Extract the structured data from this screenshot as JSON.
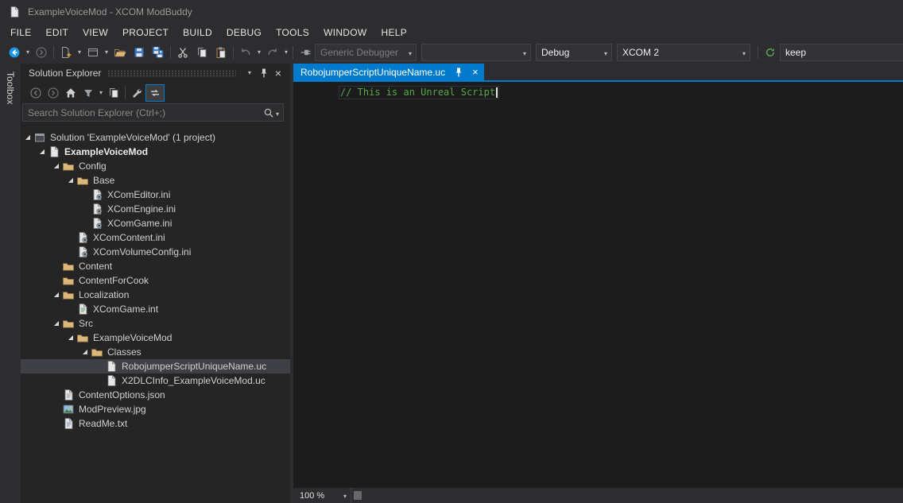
{
  "window": {
    "title": "ExampleVoiceMod - XCOM ModBuddy"
  },
  "menu": {
    "items": [
      "FILE",
      "EDIT",
      "VIEW",
      "PROJECT",
      "BUILD",
      "DEBUG",
      "TOOLS",
      "WINDOW",
      "HELP"
    ]
  },
  "toolbar": {
    "debugger_label": "Generic Debugger",
    "empty_value": "",
    "config_value": "Debug",
    "platform_value": "XCOM 2",
    "keep_value": "keep"
  },
  "toolbox": {
    "label": "Toolbox"
  },
  "solution_explorer": {
    "title": "Solution Explorer",
    "search_placeholder": "Search Solution Explorer (Ctrl+;)",
    "tree": [
      {
        "label": "Solution 'ExampleVoiceMod' (1 project)",
        "level": 0,
        "icon": "solution",
        "expanded": true
      },
      {
        "label": "ExampleVoiceMod",
        "level": 1,
        "icon": "project",
        "expanded": true,
        "bold": true
      },
      {
        "label": "Config",
        "level": 2,
        "icon": "folder",
        "expanded": true
      },
      {
        "label": "Base",
        "level": 3,
        "icon": "folder",
        "expanded": true
      },
      {
        "label": "XComEditor.ini",
        "level": 4,
        "icon": "ini"
      },
      {
        "label": "XComEngine.ini",
        "level": 4,
        "icon": "ini"
      },
      {
        "label": "XComGame.ini",
        "level": 4,
        "icon": "ini"
      },
      {
        "label": "XComContent.ini",
        "level": 3,
        "icon": "ini"
      },
      {
        "label": "XComVolumeConfig.ini",
        "level": 3,
        "icon": "ini"
      },
      {
        "label": "Content",
        "level": 2,
        "icon": "folder"
      },
      {
        "label": "ContentForCook",
        "level": 2,
        "icon": "folder"
      },
      {
        "label": "Localization",
        "level": 2,
        "icon": "folder",
        "expanded": true
      },
      {
        "label": "XComGame.int",
        "level": 3,
        "icon": "int"
      },
      {
        "label": "Src",
        "level": 2,
        "icon": "folder",
        "expanded": true
      },
      {
        "label": "ExampleVoiceMod",
        "level": 3,
        "icon": "folder",
        "expanded": true
      },
      {
        "label": "Classes",
        "level": 4,
        "icon": "folder",
        "expanded": true
      },
      {
        "label": "RobojumperScriptUniqueName.uc",
        "level": 5,
        "icon": "uc",
        "selected": true
      },
      {
        "label": "X2DLCInfo_ExampleVoiceMod.uc",
        "level": 5,
        "icon": "uc"
      },
      {
        "label": "ContentOptions.json",
        "level": 2,
        "icon": "json"
      },
      {
        "label": "ModPreview.jpg",
        "level": 2,
        "icon": "image"
      },
      {
        "label": "ReadMe.txt",
        "level": 2,
        "icon": "txt"
      }
    ]
  },
  "editor": {
    "tab_title": "RobojumperScriptUniqueName.uc",
    "code_line": "// This is an Unreal Script",
    "zoom_level": "100 %"
  },
  "colors": {
    "accent_blue": "#007acc",
    "window_bg": "#2d2d30",
    "panel_bg": "#252526",
    "editor_bg": "#1c1c1c",
    "comment_green": "#57a64a",
    "folder_tan": "#dcb67a",
    "selection_inactive": "#3f3f46"
  },
  "icons": {
    "app-icon": "white document",
    "navigate-back-icon": "blue circle with left arrow",
    "navigate-forward-icon": "gray circle with right arrow (disabled)",
    "new-item-icon": "document with plus",
    "window-layout-icon": "window outline",
    "open-folder-icon": "tan open folder",
    "save-icon": "blue floppy disk",
    "save-all-icon": "two blue floppy disks",
    "cut-icon": "scissors",
    "copy-icon": "two documents",
    "paste-icon": "clipboard",
    "undo-icon": "curved left arrow (disabled)",
    "redo-icon": "curved right arrow (disabled)",
    "attach-debugger-icon": "plug connector",
    "build-config-icon": "green circular arrow",
    "home-icon": "house",
    "filter-icon": "stacked documents filter",
    "sync-docs-icon": "two horizontal arrows",
    "properties-icon": "wrench",
    "preview-icon": "document with lines (toggled, blue border)",
    "pin-icon": "pin",
    "close-icon": "x cross",
    "chevron-down-icon": "small down triangle",
    "search-icon": "magnifier",
    "expand-arrow-icon": "filled lower-right triangle",
    "folder-icon": "tan folder",
    "solution-icon": "window frame",
    "gear-file-icon": "document with gear",
    "image-file-icon": "picture with mountain",
    "text-file-icon": "document with lines"
  }
}
